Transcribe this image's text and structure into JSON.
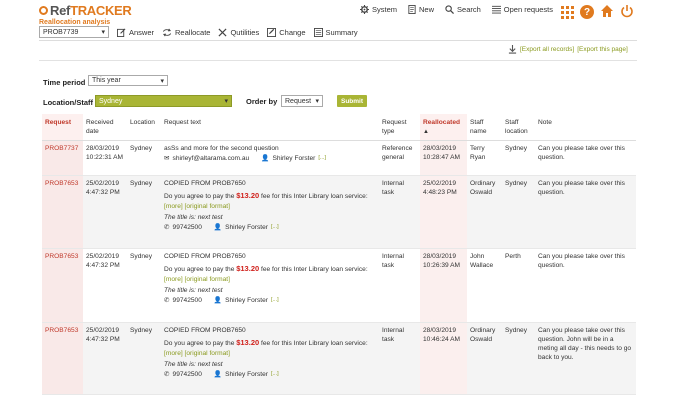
{
  "app": {
    "logo_prefix": "Ref",
    "logo_suffix": "TRACKER",
    "subtitle": "Reallocation analysis",
    "accent": "#e07a1f",
    "green": "#a9b535",
    "red": "#c0392b"
  },
  "topnav": {
    "system": "System",
    "new": "New",
    "search": "Search",
    "open_requests": "Open requests"
  },
  "toolbar": {
    "request_select": "PROB7739",
    "answer": "Answer",
    "reallocate": "Reallocate",
    "qutilities": "Qutilities",
    "change": "Change",
    "summary": "Summary"
  },
  "export": {
    "all": "[Export all records]",
    "page": "[Export this page]"
  },
  "filters": {
    "time_period_label": "Time period",
    "time_period_value": "This year",
    "location_label": "Location/Staff",
    "location_value": "Sydney",
    "order_by_label": "Order by",
    "order_by_value": "Request",
    "submit": "Submit"
  },
  "table": {
    "headers": {
      "request": "Request",
      "received": "Received date",
      "location": "Location",
      "request_text": "Request text",
      "request_type": "Request type",
      "reallocated": "Reallocated",
      "staff_name": "Staff name",
      "staff_location": "Staff location",
      "note": "Note"
    },
    "rows": [
      {
        "id": "PROB7737",
        "received": "28/03/2019 10:22:31 AM",
        "location": "Sydney",
        "text_main": "asSs  and more for the second question",
        "email": "shirleyf@altarama.com.au",
        "person": "Shirley Forster",
        "person_more": "[...]",
        "type": "Reference general",
        "reallocated": "28/03/2019 10:28:47 AM",
        "staff_name": "Terry Ryan",
        "staff_location": "Sydney",
        "note": "Can you please take over this question."
      },
      {
        "id": "PROB7653",
        "received": "25/02/2019 4:47:32 PM",
        "location": "Sydney",
        "copied": "COPIED FROM PROB7650",
        "q_before": "Do you agree to pay the ",
        "fee": "$13.20",
        "q_after": " fee for this Inter Library loan service:",
        "more": "[more]",
        "original": "[original format]",
        "title": "The title is: next test",
        "phone": "99742500",
        "person": "Shirley Forster",
        "person_more": "[...]",
        "type": "Internal task",
        "reallocated": "25/02/2019 4:48:23 PM",
        "staff_name": "Ordinary Oswald",
        "staff_location": "Sydney",
        "note": "Can you please take over this question."
      },
      {
        "id": "PROB7653",
        "received": "25/02/2019 4:47:32 PM",
        "location": "Sydney",
        "copied": "COPIED FROM PROB7650",
        "q_before": "Do you agree to pay the ",
        "fee": "$13.20",
        "q_after": " fee for this Inter Library loan service:",
        "more": "[more]",
        "original": "[original format]",
        "title": "The title is: next test",
        "phone": "99742500",
        "person": "Shirley Forster",
        "person_more": "[...]",
        "type": "Internal task",
        "reallocated": "28/03/2019 10:26:39 AM",
        "staff_name": "John Wallace",
        "staff_location": "Perth",
        "note": "Can you please take over this question."
      },
      {
        "id": "PROB7653",
        "received": "25/02/2019 4:47:32 PM",
        "location": "Sydney",
        "copied": "COPIED FROM PROB7650",
        "q_before": "Do you agree to pay the ",
        "fee": "$13.20",
        "q_after": " fee for this Inter Library loan service:",
        "more": "[more]",
        "original": "[original format]",
        "title": "The title is: next test",
        "phone": "99742500",
        "person": "Shirley Forster",
        "person_more": "[...]",
        "type": "Internal task",
        "reallocated": "28/03/2019 10:46:24 AM",
        "staff_name": "Ordinary Oswald",
        "staff_location": "Sydney",
        "note": "Can you please take over this question.  John will be in a meting all day - this needs to go back to you."
      }
    ]
  }
}
